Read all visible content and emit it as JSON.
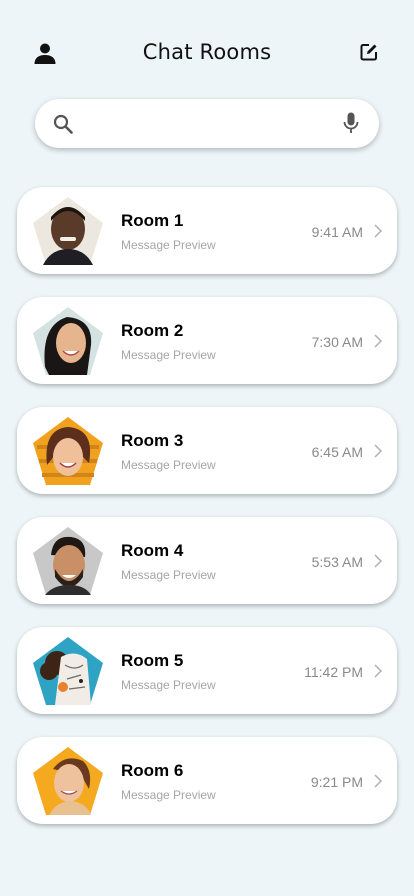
{
  "header": {
    "title": "Chat Rooms",
    "profile_icon": "person-icon",
    "compose_icon": "compose-icon"
  },
  "search": {
    "value": "",
    "placeholder": "",
    "search_icon": "search-icon",
    "mic_icon": "mic-icon"
  },
  "rooms": [
    {
      "name": "Room 1",
      "preview": "Message Preview",
      "time": "9:41 AM",
      "avatar_bg": "#ece7df"
    },
    {
      "name": "Room 2",
      "preview": "Message Preview",
      "time": "7:30 AM",
      "avatar_bg": "#d5e2e2"
    },
    {
      "name": "Room 3",
      "preview": "Message Preview",
      "time": "6:45 AM",
      "avatar_bg": "#f0a21f"
    },
    {
      "name": "Room 4",
      "preview": "Message Preview",
      "time": "5:53 AM",
      "avatar_bg": "#c8c8c8"
    },
    {
      "name": "Room 5",
      "preview": "Message Preview",
      "time": "11:42 PM",
      "avatar_bg": "#2fa3c4"
    },
    {
      "name": "Room 6",
      "preview": "Message Preview",
      "time": "9:21 PM",
      "avatar_bg": "#f4a91f"
    }
  ],
  "colors": {
    "background": "#edf5f8",
    "card": "#ffffff",
    "preview_text": "#a5a5a5",
    "time_text": "#8a8a8a"
  }
}
